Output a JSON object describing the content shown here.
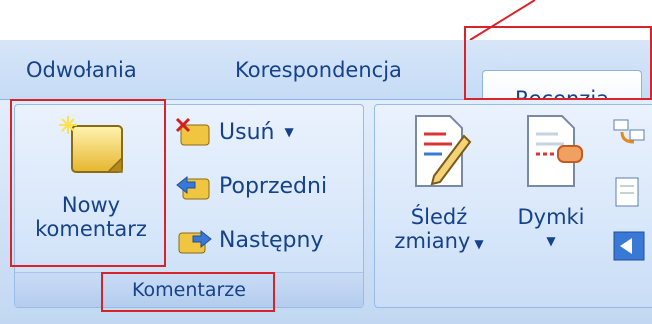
{
  "tabs": {
    "references": "Odwołania",
    "mailings": "Korespondencja",
    "review": "Recenzja"
  },
  "comments_group": {
    "new_comment_line1": "Nowy",
    "new_comment_line2": "komentarz",
    "delete": "Usuń",
    "previous": "Poprzedni",
    "next": "Następny",
    "group_label": "Komentarze"
  },
  "tracking_group": {
    "track_changes_line1": "Śledź",
    "track_changes_line2": "zmiany",
    "balloons": "Dymki"
  },
  "icons": {
    "new_comment": "new-comment-icon",
    "delete": "delete-comment-icon",
    "previous": "previous-comment-icon",
    "next": "next-comment-icon",
    "track_changes": "track-changes-icon",
    "balloons": "balloons-icon",
    "dropdown": "chevron-down-icon"
  },
  "colors": {
    "label_text": "#15428b",
    "highlight_red": "#d8232a",
    "ribbon_bg": "#cfe0f6"
  }
}
